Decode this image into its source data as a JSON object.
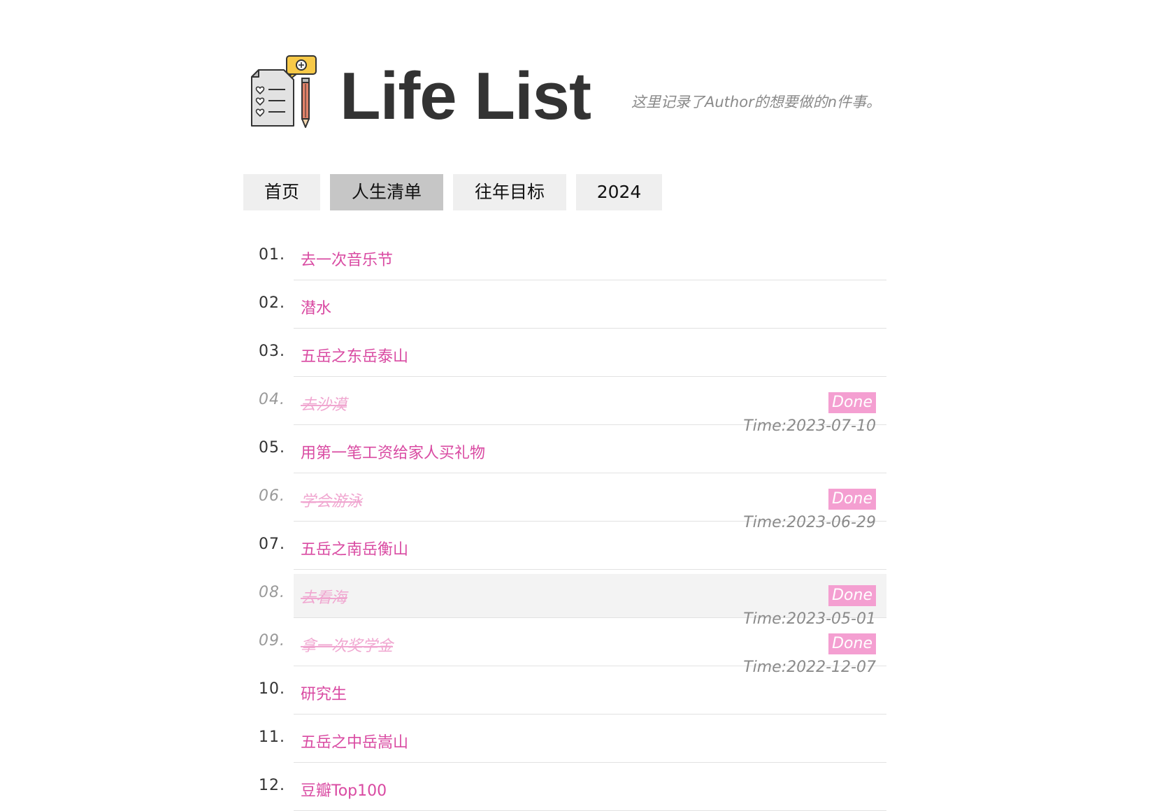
{
  "header": {
    "title": "Life List",
    "subtitle": "这里记录了Author的想要做的n件事。",
    "logo_icon": "checklist-pencil-icon"
  },
  "nav": {
    "tabs": [
      {
        "label": "首页",
        "active": false
      },
      {
        "label": "人生清单",
        "active": true
      },
      {
        "label": "往年目标",
        "active": false
      },
      {
        "label": "2024",
        "active": false
      }
    ]
  },
  "colors": {
    "item_text": "#d94aa2",
    "done_text": "#f0a6d0",
    "done_badge": "#f49fd1",
    "active_tab": "#c6c6c6",
    "tab": "#efefef"
  },
  "list": {
    "items": [
      {
        "num": "01.",
        "text": "去一次音乐节",
        "done": false
      },
      {
        "num": "02.",
        "text": "潜水",
        "done": false
      },
      {
        "num": "03.",
        "text": "五岳之东岳泰山",
        "done": false
      },
      {
        "num": "04.",
        "text": "去沙漠",
        "done": true,
        "badge": "Done",
        "time": "Time:2023-07-10"
      },
      {
        "num": "05.",
        "text": "用第一笔工资给家人买礼物",
        "done": false
      },
      {
        "num": "06.",
        "text": "学会游泳",
        "done": true,
        "badge": "Done",
        "time": "Time:2023-06-29"
      },
      {
        "num": "07.",
        "text": "五岳之南岳衡山",
        "done": false
      },
      {
        "num": "08.",
        "text": "去看海",
        "done": true,
        "badge": "Done",
        "time": "Time:2023-05-01"
      },
      {
        "num": "09.",
        "text": "拿一次奖学金",
        "done": true,
        "badge": "Done",
        "time": "Time:2022-12-07"
      },
      {
        "num": "10.",
        "text": "研究生",
        "done": false
      },
      {
        "num": "11.",
        "text": "五岳之中岳嵩山",
        "done": false
      },
      {
        "num": "12.",
        "text": "豆瓣Top100",
        "done": false
      }
    ]
  }
}
